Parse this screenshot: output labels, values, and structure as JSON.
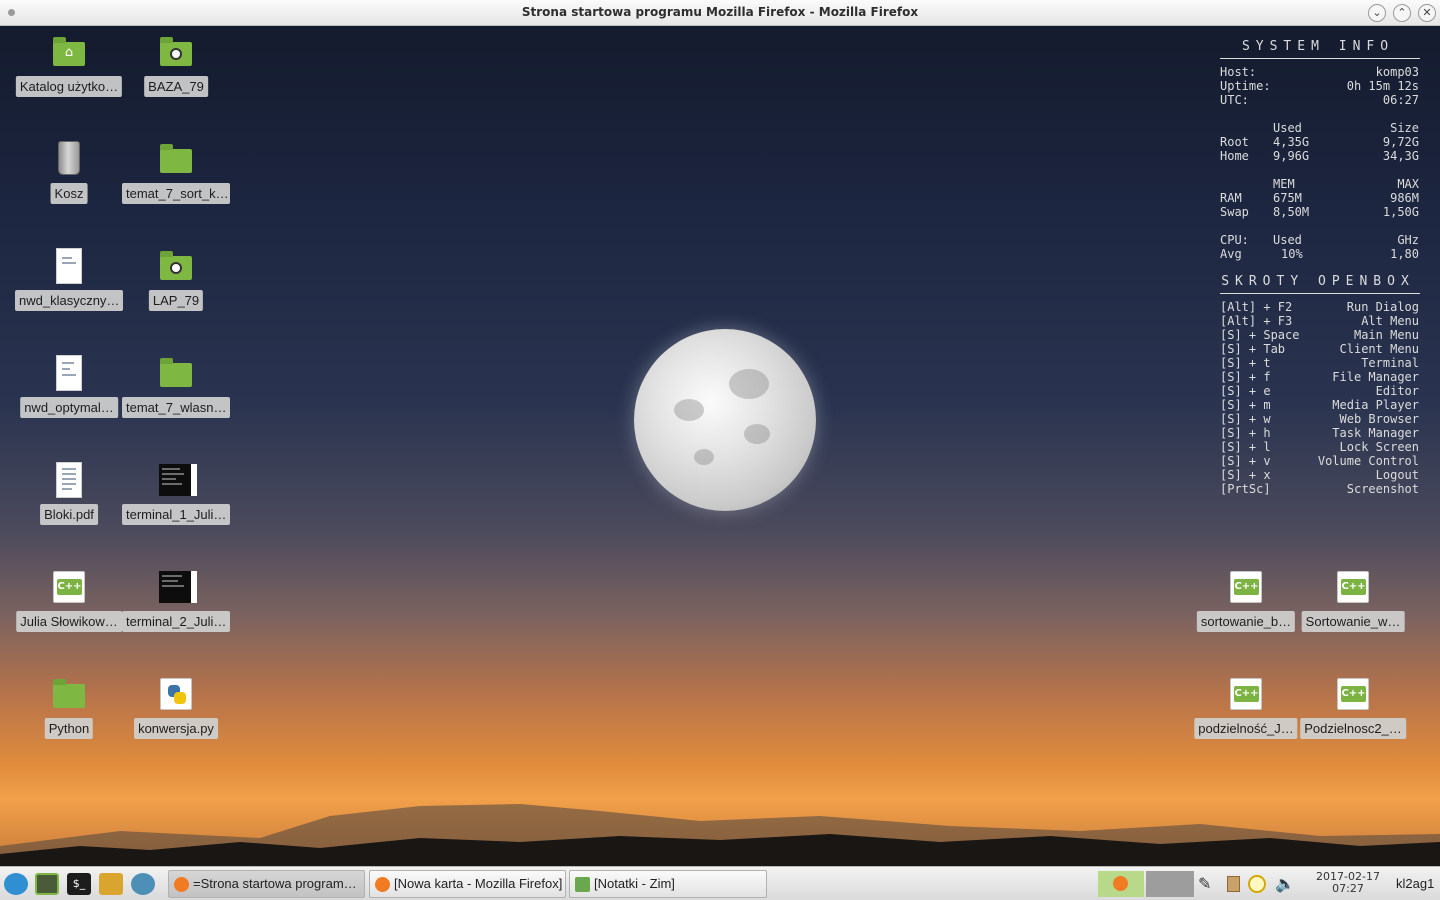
{
  "window": {
    "title": "Strona startowa programu Mozilla Firefox - Mozilla Firefox"
  },
  "desktop_icons": [
    {
      "label": "Katalog użytko…",
      "icon": "home-folder-icon"
    },
    {
      "label": "BAZA_79",
      "icon": "network-folder-icon"
    },
    {
      "label": "Kosz",
      "icon": "trash-icon"
    },
    {
      "label": "temat_7_sort_k…",
      "icon": "folder-icon"
    },
    {
      "label": "nwd_klasyczny…",
      "icon": "document-icon"
    },
    {
      "label": "LAP_79",
      "icon": "network-folder-icon"
    },
    {
      "label": "nwd_optymal…",
      "icon": "document-icon"
    },
    {
      "label": "temat_7_wlasn…",
      "icon": "folder-icon"
    },
    {
      "label": "Bloki.pdf",
      "icon": "pdf-icon"
    },
    {
      "label": "terminal_1_Juli…",
      "icon": "image-thumbnail-icon"
    },
    {
      "label": "Julia Słowikow…",
      "icon": "cpp-file-icon"
    },
    {
      "label": "terminal_2_Juli…",
      "icon": "image-thumbnail-icon"
    },
    {
      "label": "Python",
      "icon": "folder-icon"
    },
    {
      "label": "konwersja.py",
      "icon": "python-file-icon"
    },
    {
      "label": "sortowanie_b…",
      "icon": "cpp-file-icon"
    },
    {
      "label": "Sortowanie_w…",
      "icon": "cpp-file-icon"
    },
    {
      "label": "podzielność_J…",
      "icon": "cpp-file-icon"
    },
    {
      "label": "Podzielnosc2_…",
      "icon": "cpp-file-icon"
    }
  ],
  "conky": {
    "system_title": "SYSTEM  INFO",
    "host_label": "Host:",
    "host": "komp03",
    "uptime_label": "Uptime:",
    "uptime": "0h 15m 12s",
    "utc_label": "UTC:",
    "utc": "06:27",
    "disk_used_header": "Used",
    "disk_size_header": "Size",
    "root_label": "Root",
    "root_used": "4,35G",
    "root_size": "9,72G",
    "home_label": "Home",
    "home_used": "9,96G",
    "home_size": "34,3G",
    "mem_header": "MEM",
    "max_header": "MAX",
    "ram_label": "RAM",
    "ram_mem": "675M",
    "ram_max": "986M",
    "swap_label": "Swap",
    "swap_mem": "8,50M",
    "swap_max": "1,50G",
    "cpu_label": "CPU:",
    "cpu_used_header": "Used",
    "cpu_ghz_header": "GHz",
    "avg_label": "Avg",
    "avg_used": "10%",
    "avg_ghz": "1,80",
    "shortcuts_title": "SKROTY  OPENBOX",
    "shortcuts": [
      {
        "keys": "[Alt] + F2",
        "action": "Run Dialog"
      },
      {
        "keys": "[Alt] + F3",
        "action": "Alt Menu"
      },
      {
        "keys": "[S] + Space",
        "action": "Main Menu"
      },
      {
        "keys": "[S] + Tab",
        "action": "Client Menu"
      },
      {
        "keys": "[S] + t",
        "action": "Terminal"
      },
      {
        "keys": "[S] + f",
        "action": "File Manager"
      },
      {
        "keys": "[S] + e",
        "action": "Editor"
      },
      {
        "keys": "[S] + m",
        "action": "Media Player"
      },
      {
        "keys": "[S] + w",
        "action": "Web Browser"
      },
      {
        "keys": "[S] + h",
        "action": "Task Manager"
      },
      {
        "keys": "[S] + l",
        "action": "Lock Screen"
      },
      {
        "keys": "[S] + v",
        "action": "Volume Control"
      },
      {
        "keys": "[S] + x",
        "action": "Logout"
      },
      {
        "keys": "[PrtSc]",
        "action": "Screenshot"
      }
    ]
  },
  "taskbar": {
    "launchers": [
      "menu-icon",
      "file-manager-icon",
      "terminal-icon",
      "home-folder-icon",
      "browser-icon"
    ],
    "tasks": [
      {
        "label": "=Strona startowa program…",
        "icon": "firefox-icon"
      },
      {
        "label": "[Nowa karta - Mozilla Firefox]",
        "icon": "firefox-icon"
      },
      {
        "label": "[Notatki - Zim]",
        "icon": "zim-icon"
      }
    ],
    "tray": [
      "firefox-icon",
      "pencil-icon",
      "clipboard-icon",
      "power-icon",
      "volume-icon"
    ],
    "clock_date": "2017-02-17",
    "clock_time": "07:27",
    "user": "kl2ag1"
  },
  "colors": {
    "accent": "#7cb342",
    "folder": "#7fb743",
    "conky_text": "#dcdcdc"
  }
}
